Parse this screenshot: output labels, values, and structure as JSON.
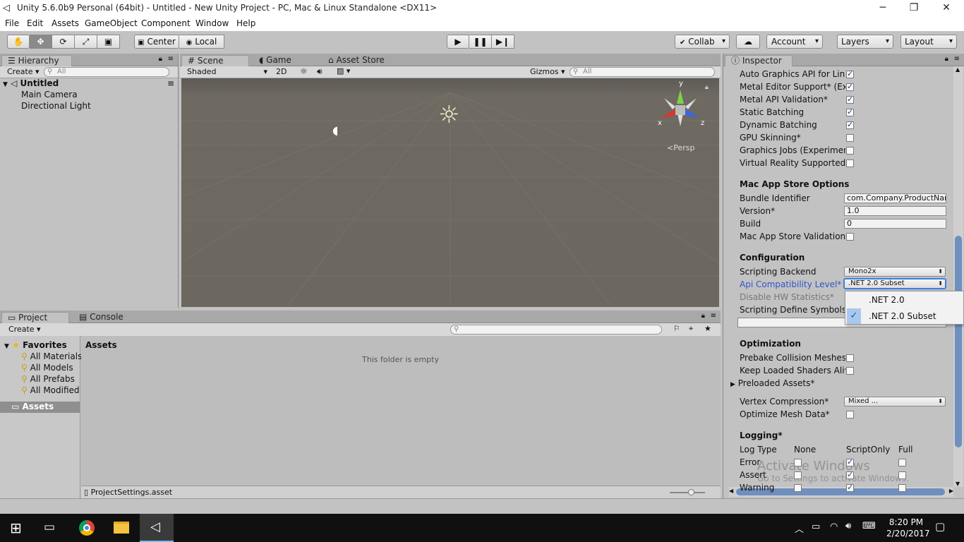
{
  "window": {
    "title": "Unity 5.6.0b9 Personal (64bit) - Untitled - New Unity Project - PC, Mac & Linux Standalone <DX11>",
    "minimize": "─",
    "restore": "❐",
    "close": "✕"
  },
  "menu": [
    "File",
    "Edit",
    "Assets",
    "GameObject",
    "Component",
    "Window",
    "Help"
  ],
  "toolbar": {
    "center": "Center",
    "local": "Local",
    "collab": "Collab",
    "account": "Account",
    "layers": "Layers",
    "layout": "Layout"
  },
  "hierarchy": {
    "tab": "Hierarchy",
    "create": "Create",
    "search_placeholder": "All",
    "scene": "Untitled",
    "items": [
      "Main Camera",
      "Directional Light"
    ]
  },
  "scene": {
    "tabs": [
      "Scene",
      "Game",
      "Asset Store"
    ],
    "shading": "Shaded",
    "mode2d": "2D",
    "gizmos": "Gizmos",
    "search_placeholder": "All",
    "axes": {
      "y": "y",
      "x": "x",
      "z": "z"
    },
    "persp": "Persp"
  },
  "project": {
    "tabs": [
      "Project",
      "Console"
    ],
    "create": "Create",
    "favorites_label": "Favorites",
    "favorites": [
      "All Materials",
      "All Models",
      "All Prefabs",
      "All Modified"
    ],
    "assets_folder": "Assets",
    "assets_header": "Assets",
    "empty_message": "This folder is empty",
    "footer_file": "ProjectSettings.asset"
  },
  "inspector": {
    "tab": "Inspector",
    "rendering_rows": [
      {
        "label": "Auto Graphics API for Linux",
        "checked": true
      },
      {
        "label": "Metal Editor Support* (Experimental)",
        "checked": true
      },
      {
        "label": "Metal API Validation*",
        "checked": true
      },
      {
        "label": "Static Batching",
        "checked": true
      },
      {
        "label": "Dynamic Batching",
        "checked": true
      },
      {
        "label": "GPU Skinning*",
        "checked": false
      },
      {
        "label": "Graphics Jobs (Experimental)",
        "checked": false
      },
      {
        "label": "Virtual Reality Supported",
        "checked": false
      }
    ],
    "mac_header": "Mac App Store Options",
    "bundle_id_label": "Bundle Identifier",
    "bundle_id_value": "com.Company.ProductName",
    "version_label": "Version*",
    "version_value": "1.0",
    "build_label": "Build",
    "build_value": "0",
    "mas_validation_label": "Mac App Store Validation",
    "config_header": "Configuration",
    "scripting_backend_label": "Scripting Backend",
    "scripting_backend_value": "Mono2x",
    "api_level_label": "Api Compatibility Level*",
    "api_level_value": ".NET 2.0 Subset",
    "disable_hw_label": "Disable HW Statistics*",
    "define_symbols_label": "Scripting Define Symbols*",
    "api_options": [
      {
        "label": ".NET 2.0",
        "selected": false
      },
      {
        "label": ".NET 2.0 Subset",
        "selected": true
      }
    ],
    "opt_header": "Optimization",
    "prebake_label": "Prebake Collision Meshes*",
    "keep_shaders_label": "Keep Loaded Shaders Alive*",
    "preloaded_label": "Preloaded Assets*",
    "vertex_comp_label": "Vertex Compression*",
    "vertex_comp_value": "Mixed ...",
    "optimize_mesh_label": "Optimize Mesh Data*",
    "logging_header": "Logging*",
    "log_cols": [
      "Log Type",
      "None",
      "ScriptOnly",
      "Full"
    ],
    "log_rows": [
      {
        "label": "Error",
        "none": false,
        "scriptonly": true,
        "full": false
      },
      {
        "label": "Assert",
        "none": false,
        "scriptonly": true,
        "full": false
      },
      {
        "label": "Warning",
        "none": false,
        "scriptonly": true,
        "full": false
      }
    ],
    "watermark_title": "Activate Windows",
    "watermark_sub": "Go to Settings to activate Windows."
  },
  "taskbar": {
    "time": "8:20 PM",
    "date": "2/20/2017"
  },
  "colors": {
    "accent": "#3e7de0",
    "chrome": "#c2c2c2",
    "scene_bg": "#6e6961",
    "taskbar": "#101010"
  }
}
